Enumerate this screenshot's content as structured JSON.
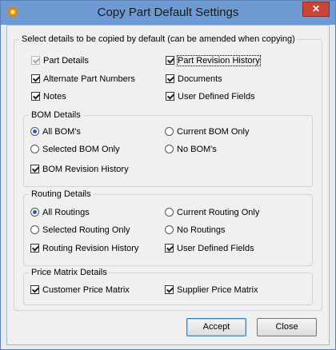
{
  "window": {
    "title": "Copy Part Default Settings",
    "close_glyph": "✕"
  },
  "main": {
    "legend": "Select details to be copied by default (can be amended when copying)",
    "part_details": "Part Details",
    "part_revision_history": "Part Revision History",
    "alternate_part_numbers": "Alternate Part Numbers",
    "documents": "Documents",
    "notes": "Notes",
    "user_defined_fields": "User Defined Fields"
  },
  "bom": {
    "legend": "BOM Details",
    "all_boms": "All BOM's",
    "current_bom_only": "Current BOM Only",
    "selected_bom_only": "Selected BOM Only",
    "no_boms": "No BOM's",
    "bom_revision_history": "BOM Revision History"
  },
  "routing": {
    "legend": "Routing Details",
    "all_routings": "All Routings",
    "current_routing_only": "Current Routing Only",
    "selected_routing_only": "Selected Routing Only",
    "no_routings": "No Routings",
    "routing_revision_history": "Routing Revision History",
    "user_defined_fields": "User Defined Fields"
  },
  "price": {
    "legend": "Price Matrix Details",
    "customer_price_matrix": "Customer Price Matrix",
    "supplier_price_matrix": "Supplier Price Matrix"
  },
  "buttons": {
    "accept": "Accept",
    "close": "Close"
  },
  "colors": {
    "titlebar": "#6e9ad3",
    "close_button": "#c9453a",
    "radio_dot": "#1d5fbf"
  },
  "icons": {
    "app": "gear-icon",
    "close": "close-icon"
  }
}
